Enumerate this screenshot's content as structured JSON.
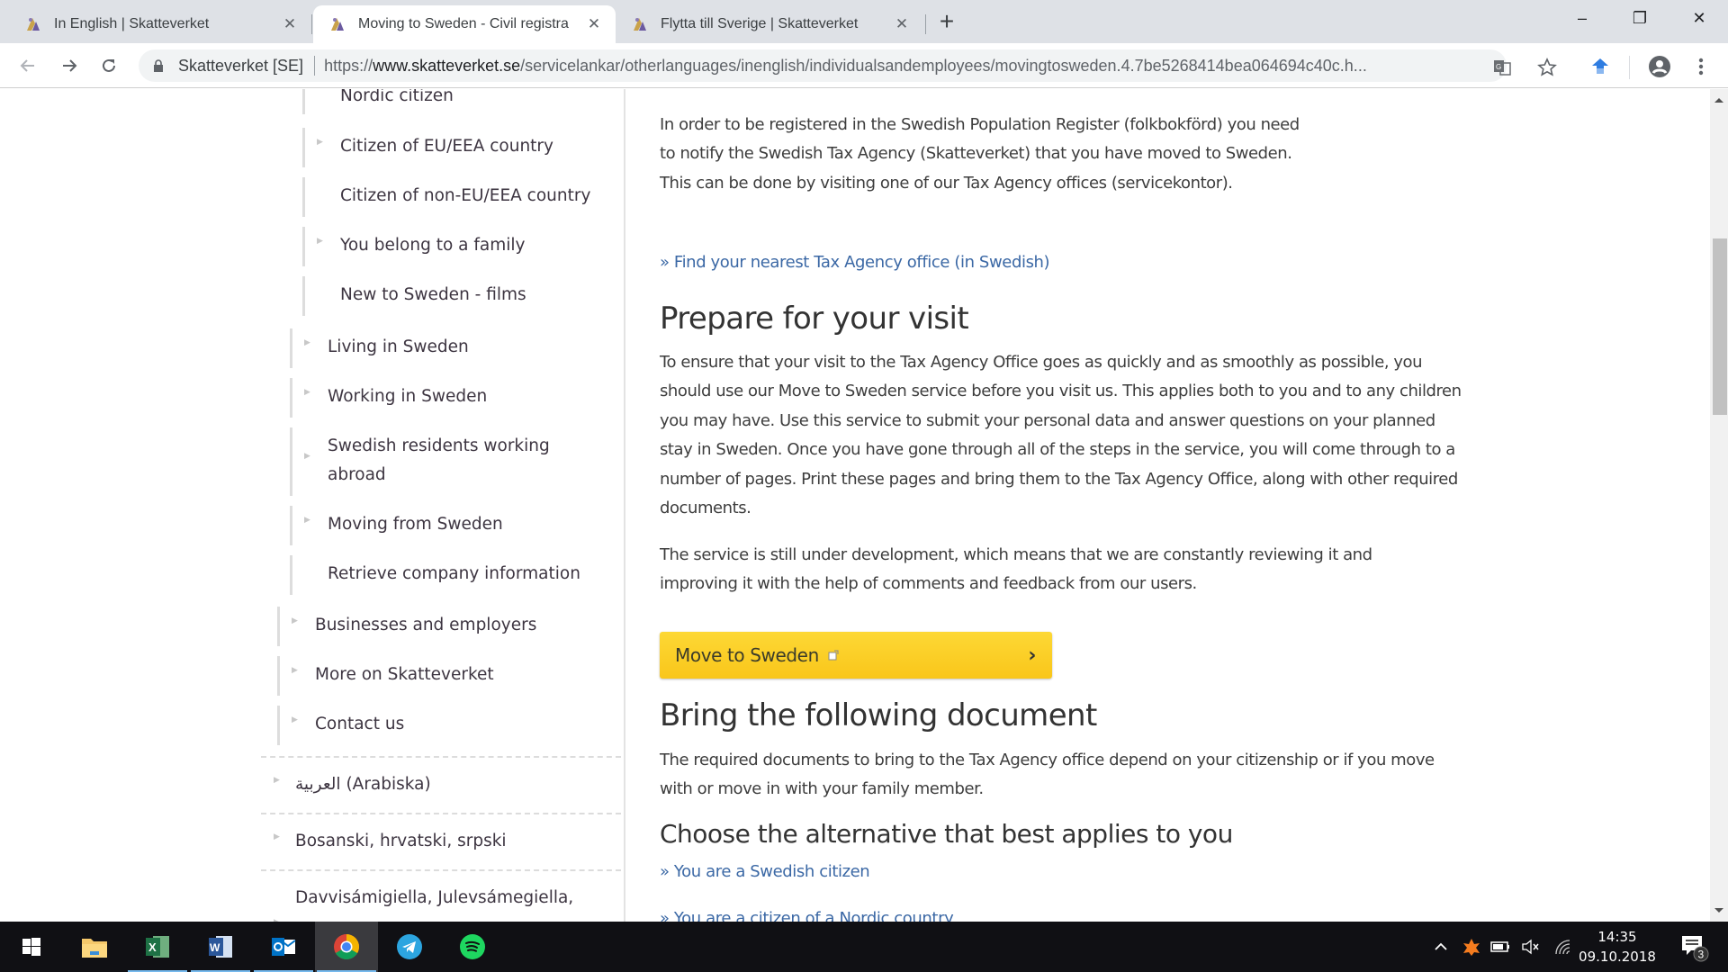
{
  "browser": {
    "tabs": [
      {
        "title": "In English | Skatteverket",
        "active": false,
        "icon": "skatteverket-favicon"
      },
      {
        "title": "Moving to Sweden - Civil registra",
        "active": true,
        "icon": "skatteverket-favicon"
      },
      {
        "title": "Flytta till Sverige | Skatteverket",
        "active": false,
        "icon": "skatteverket-favicon"
      }
    ],
    "tab_close_label": "✕",
    "new_tab_label": "+",
    "window_controls": {
      "minimize": "–",
      "restore": "❐",
      "close": "✕"
    },
    "address_bar": {
      "site_identity": "Skatteverket [SE]",
      "url_scheme": "https://",
      "url_host": "www.skatteverket.se",
      "url_path": "/servicelankar/otherlanguages/inenglish/individualsandemployees/movingtosweden.4.7be5268414bea064694c40c.h..."
    }
  },
  "sidebar": {
    "items": [
      {
        "label": "Nordic citizen",
        "level": 3,
        "has_children": false
      },
      {
        "label": "Citizen of EU/EEA country",
        "level": 3,
        "has_children": true
      },
      {
        "label": "Citizen of non-EU/EEA country",
        "level": 3,
        "has_children": false
      },
      {
        "label": "You belong to a family",
        "level": 3,
        "has_children": true
      },
      {
        "label": "New to Sweden - films",
        "level": 3,
        "has_children": false
      },
      {
        "label": "Living in Sweden",
        "level": 2,
        "has_children": true
      },
      {
        "label": "Working in Sweden",
        "level": 2,
        "has_children": true
      },
      {
        "label": "Swedish residents working abroad",
        "level": 2,
        "has_children": true
      },
      {
        "label": "Moving from Sweden",
        "level": 2,
        "has_children": true
      },
      {
        "label": "Retrieve company information",
        "level": 2,
        "has_children": false
      },
      {
        "label": "Businesses and employers",
        "level": 1,
        "has_children": true
      },
      {
        "label": "More on Skatteverket",
        "level": 1,
        "has_children": true
      },
      {
        "label": "Contact us",
        "level": 1,
        "has_children": true
      }
    ],
    "languages": [
      {
        "label": "العربية (Arabiska)"
      },
      {
        "label": "Bosanski, hrvatski, srpski"
      },
      {
        "label": "Davvisámigiella, Julevsámegiella,"
      }
    ]
  },
  "main": {
    "intro_paragraph": "In order to be registered in the Swedish Population Register (folkbokförd) you need to notify the Swedish Tax Agency (Skatteverket) that you have moved to Sweden. This can be done by visiting one of our Tax Agency offices (servicekontor).",
    "office_link": "» Find your nearest Tax Agency office (in Swedish)",
    "prepare_heading": "Prepare for your visit",
    "prepare_paragraph": "To ensure that your visit to the Tax Agency Office goes as quickly and as smoothly as possible, you should use our Move to Sweden service before you visit us. This applies both to you and to any children you may have. Use this service to submit your personal data and answer questions on your planned stay in Sweden. Once you have gone through all of the steps in the service, you will come through to a number of pages. Print these pages and bring them to the Tax Agency Office, along with other required documents.",
    "development_paragraph": "The service is still under development, which means that we are constantly reviewing it and improving it with the help of comments and feedback from our users.",
    "cta_button": "Move to Sweden",
    "bring_heading": "Bring the following document",
    "bring_paragraph": "The required documents to bring to the Tax Agency office depend on your citizenship or if you move with or move in with your family member.",
    "choose_heading": "Choose the alternative that best applies to you",
    "alternatives": [
      "» You are a Swedish citizen",
      "» You are a citizen of a Nordic country"
    ]
  },
  "taskbar": {
    "apps": [
      "start",
      "file-explorer",
      "excel",
      "word",
      "outlook",
      "chrome",
      "telegram",
      "spotify"
    ],
    "active_app": "chrome",
    "time": "14:35",
    "date": "09.10.2018",
    "notification_count": "3"
  },
  "colors": {
    "link": "#3b68a5",
    "cta_yellow": "#fdd835",
    "text": "#3d3d3d"
  }
}
